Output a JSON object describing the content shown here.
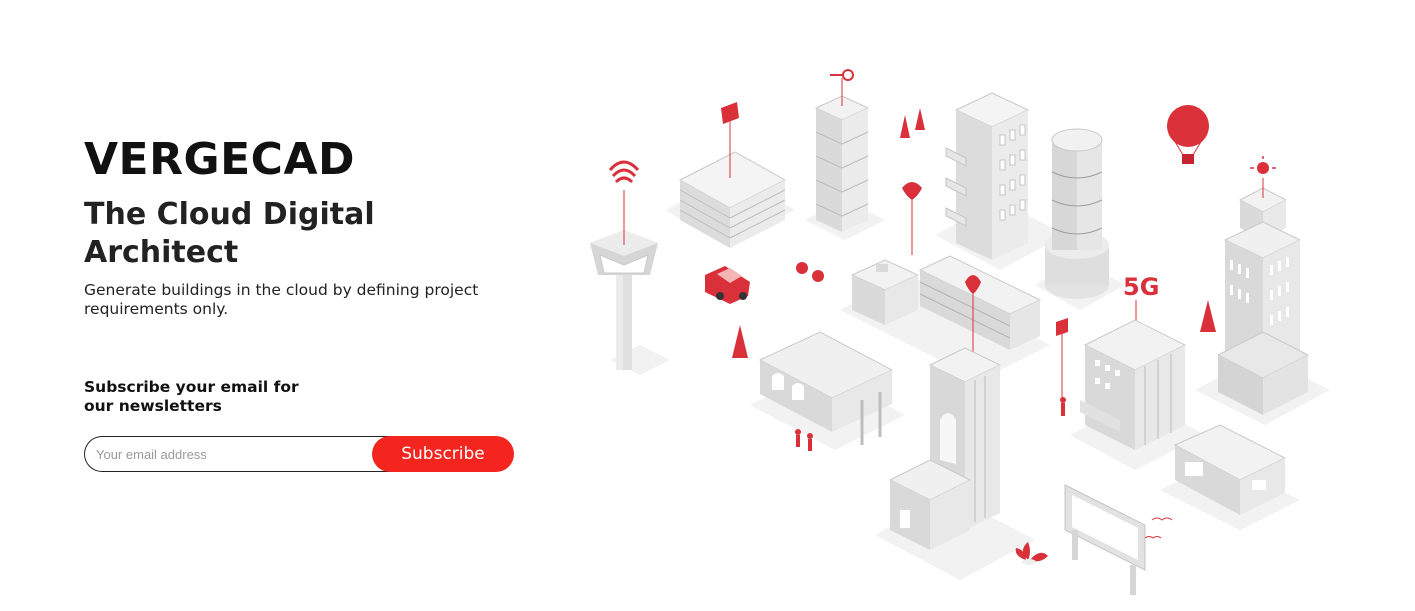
{
  "hero": {
    "brand": "VERGECAD",
    "tagline": "The Cloud Digital Architect",
    "description": "Generate buildings in the cloud by defining project requirements only."
  },
  "newsletter": {
    "heading": "Subscribe your email for our newsletters",
    "email_placeholder": "Your email address",
    "subscribe_label": "Subscribe"
  },
  "illustration": {
    "badge_5g": "5G"
  },
  "colors": {
    "accent": "#f4241e",
    "text": "#111111",
    "building": "#d9d9d9"
  }
}
